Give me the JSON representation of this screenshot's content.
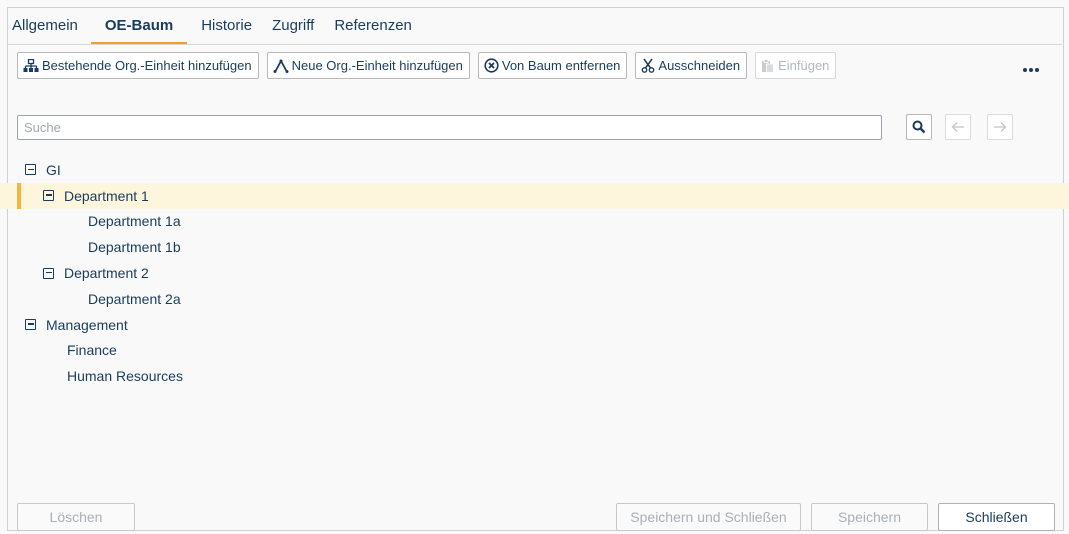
{
  "tabs": [
    {
      "label": "Allgemein"
    },
    {
      "label": "OE-Baum"
    },
    {
      "label": "Historie"
    },
    {
      "label": "Zugriff"
    },
    {
      "label": "Referenzen"
    }
  ],
  "toolbar": {
    "add_existing": "Bestehende Org.-Einheit hinzufügen",
    "add_new": "Neue Org.-Einheit hinzufügen",
    "remove": "Von Baum entfernen",
    "cut": "Ausschneiden",
    "paste": "Einfügen"
  },
  "search": {
    "placeholder": "Suche",
    "value": ""
  },
  "tree": {
    "nodes": [
      {
        "label": "GI"
      },
      {
        "label": "Department 1"
      },
      {
        "label": "Department 1a"
      },
      {
        "label": "Department 1b"
      },
      {
        "label": "Department 2"
      },
      {
        "label": "Department 2a"
      },
      {
        "label": "Management"
      },
      {
        "label": "Finance"
      },
      {
        "label": "Human Resources"
      }
    ]
  },
  "footer": {
    "delete": "Löschen",
    "save_close": "Speichern und Schließen",
    "save": "Speichern",
    "close": "Schließen"
  },
  "colors": {
    "accent": "#f0a030",
    "selected_bg": "#fdf5dc",
    "text": "#1a3c5c"
  }
}
